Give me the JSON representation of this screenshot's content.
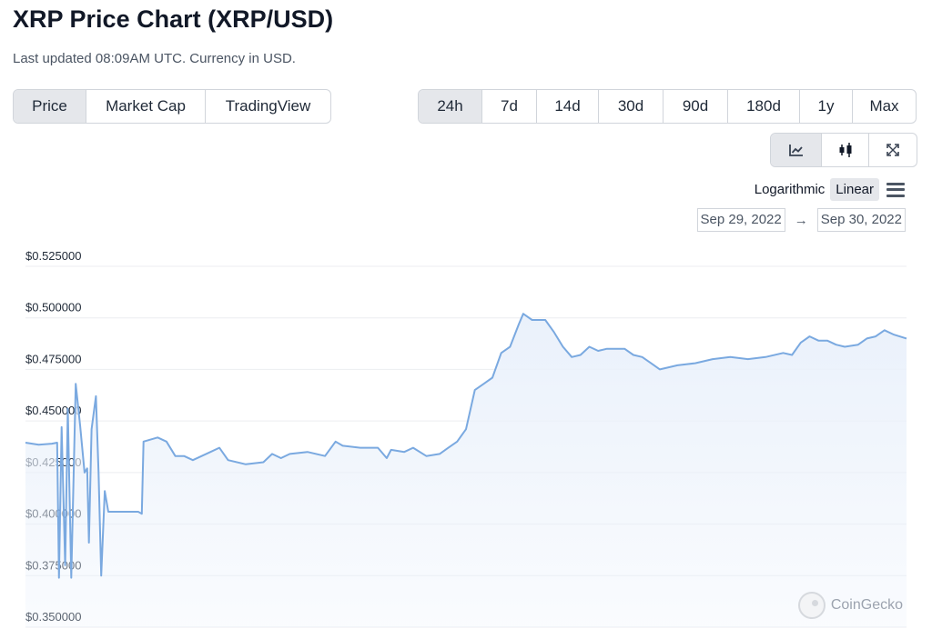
{
  "header": {
    "title": "XRP Price Chart (XRP/USD)",
    "subtitle": "Last updated 08:09AM UTC. Currency in USD."
  },
  "view_tabs": [
    {
      "label": "Price",
      "active": true
    },
    {
      "label": "Market Cap",
      "active": false
    },
    {
      "label": "TradingView",
      "active": false
    }
  ],
  "range_tabs": [
    {
      "label": "24h",
      "active": true
    },
    {
      "label": "7d",
      "active": false
    },
    {
      "label": "14d",
      "active": false
    },
    {
      "label": "30d",
      "active": false
    },
    {
      "label": "90d",
      "active": false
    },
    {
      "label": "180d",
      "active": false
    },
    {
      "label": "1y",
      "active": false
    },
    {
      "label": "Max",
      "active": false
    }
  ],
  "chart_type_buttons": [
    {
      "icon": "line-chart-icon",
      "active": true
    },
    {
      "icon": "candlestick-icon",
      "active": false
    },
    {
      "icon": "expand-icon",
      "active": false
    }
  ],
  "scale": {
    "logarithmic": "Logarithmic",
    "linear": "Linear",
    "active": "Linear"
  },
  "date_range": {
    "from": "Sep 29, 2022",
    "arrow": "→",
    "to": "Sep 30, 2022"
  },
  "watermark": "CoinGecko",
  "colors": {
    "line": "#7aa9e0",
    "fill": "#eaf1fb",
    "grid": "#eceef1"
  },
  "chart_data": {
    "type": "area",
    "y_tick_labels": [
      "$0.525000",
      "$0.500000",
      "$0.475000",
      "$0.450000",
      "$0.425000",
      "$0.400000",
      "$0.375000",
      "$0.350000"
    ],
    "y_ticks": [
      0.525,
      0.5,
      0.475,
      0.45,
      0.425,
      0.4,
      0.375,
      0.35
    ],
    "ylim": [
      0.35,
      0.525
    ],
    "xlim": [
      0,
      1
    ],
    "grid": true,
    "series": [
      {
        "values": [
          [
            0.0,
            0.4395
          ],
          [
            0.015,
            0.4385
          ],
          [
            0.03,
            0.439
          ],
          [
            0.036,
            0.4395
          ],
          [
            0.038,
            0.374
          ],
          [
            0.041,
            0.447
          ],
          [
            0.045,
            0.38
          ],
          [
            0.048,
            0.456
          ],
          [
            0.052,
            0.374
          ],
          [
            0.057,
            0.468
          ],
          [
            0.062,
            0.448
          ],
          [
            0.067,
            0.425
          ],
          [
            0.07,
            0.427
          ],
          [
            0.072,
            0.391
          ],
          [
            0.075,
            0.446
          ],
          [
            0.08,
            0.462
          ],
          [
            0.083,
            0.425
          ],
          [
            0.086,
            0.375
          ],
          [
            0.09,
            0.416
          ],
          [
            0.094,
            0.406
          ],
          [
            0.105,
            0.406
          ],
          [
            0.118,
            0.406
          ],
          [
            0.128,
            0.406
          ],
          [
            0.132,
            0.405
          ],
          [
            0.134,
            0.44
          ],
          [
            0.15,
            0.442
          ],
          [
            0.16,
            0.44
          ],
          [
            0.17,
            0.433
          ],
          [
            0.18,
            0.433
          ],
          [
            0.19,
            0.431
          ],
          [
            0.21,
            0.435
          ],
          [
            0.22,
            0.437
          ],
          [
            0.23,
            0.431
          ],
          [
            0.25,
            0.429
          ],
          [
            0.27,
            0.43
          ],
          [
            0.28,
            0.434
          ],
          [
            0.29,
            0.432
          ],
          [
            0.3,
            0.434
          ],
          [
            0.32,
            0.435
          ],
          [
            0.34,
            0.433
          ],
          [
            0.352,
            0.44
          ],
          [
            0.36,
            0.438
          ],
          [
            0.38,
            0.437
          ],
          [
            0.4,
            0.437
          ],
          [
            0.41,
            0.432
          ],
          [
            0.415,
            0.436
          ],
          [
            0.43,
            0.435
          ],
          [
            0.44,
            0.437
          ],
          [
            0.455,
            0.433
          ],
          [
            0.47,
            0.434
          ],
          [
            0.48,
            0.437
          ],
          [
            0.49,
            0.44
          ],
          [
            0.5,
            0.446
          ],
          [
            0.51,
            0.465
          ],
          [
            0.52,
            0.468
          ],
          [
            0.53,
            0.471
          ],
          [
            0.54,
            0.483
          ],
          [
            0.55,
            0.486
          ],
          [
            0.56,
            0.497
          ],
          [
            0.565,
            0.502
          ],
          [
            0.575,
            0.499
          ],
          [
            0.59,
            0.499
          ],
          [
            0.6,
            0.493
          ],
          [
            0.61,
            0.486
          ],
          [
            0.62,
            0.481
          ],
          [
            0.63,
            0.482
          ],
          [
            0.64,
            0.486
          ],
          [
            0.65,
            0.484
          ],
          [
            0.66,
            0.485
          ],
          [
            0.68,
            0.485
          ],
          [
            0.69,
            0.482
          ],
          [
            0.7,
            0.481
          ],
          [
            0.71,
            0.478
          ],
          [
            0.72,
            0.475
          ],
          [
            0.74,
            0.477
          ],
          [
            0.76,
            0.478
          ],
          [
            0.78,
            0.48
          ],
          [
            0.8,
            0.481
          ],
          [
            0.82,
            0.48
          ],
          [
            0.84,
            0.481
          ],
          [
            0.86,
            0.483
          ],
          [
            0.87,
            0.482
          ],
          [
            0.88,
            0.488
          ],
          [
            0.89,
            0.491
          ],
          [
            0.9,
            0.489
          ],
          [
            0.91,
            0.489
          ],
          [
            0.92,
            0.487
          ],
          [
            0.93,
            0.486
          ],
          [
            0.945,
            0.487
          ],
          [
            0.955,
            0.49
          ],
          [
            0.965,
            0.491
          ],
          [
            0.975,
            0.494
          ],
          [
            0.985,
            0.492
          ],
          [
            1.0,
            0.49
          ]
        ]
      }
    ]
  }
}
